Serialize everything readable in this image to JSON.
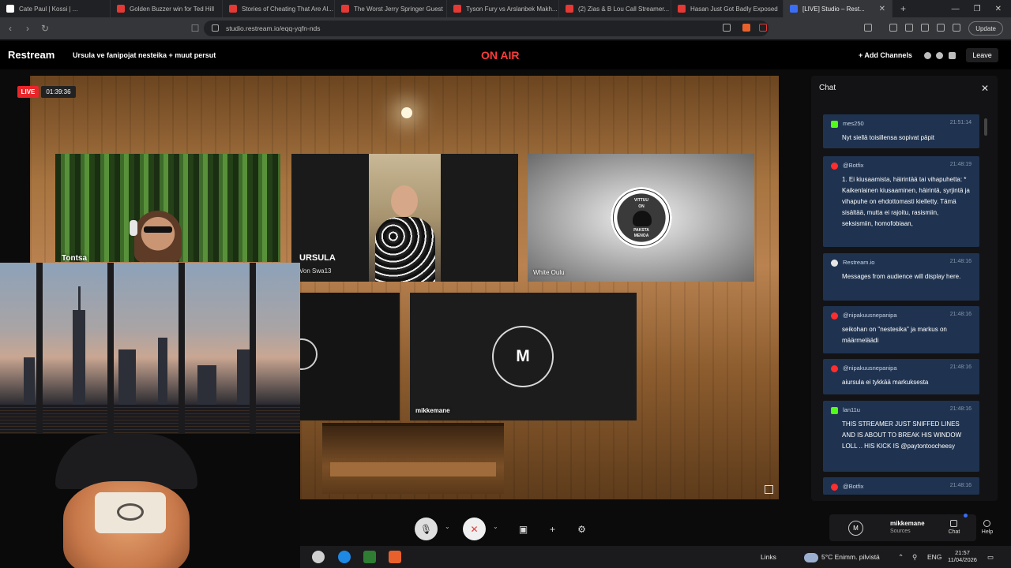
{
  "browser": {
    "tabs": [
      {
        "label": "Cate Paul | Kossi | ..."
      },
      {
        "label": "Golden Buzzer win for Ted Hill"
      },
      {
        "label": "Stories of Cheating That Are Al..."
      },
      {
        "label": "The Worst Jerry Springer Guest"
      },
      {
        "label": "Tyson Fury vs Arslanbek Makh..."
      },
      {
        "label": "(2) Zias & B Lou Call Streamer..."
      },
      {
        "label": "Hasan Just Got Badly Exposed"
      },
      {
        "label": "[LIVE] Studio – Rest..."
      }
    ],
    "url": "studio.restream.io/eqq-yqfn-nds",
    "update_label": "Update"
  },
  "header": {
    "brand": "Restream",
    "stream_title": "Ursula ve fanipojat nesteika + muut persut",
    "status": "ON AIR",
    "add_channels": "+ Add Channels",
    "leave": "Leave"
  },
  "stage": {
    "live_badge": "LIVE",
    "timer": "01:39:36",
    "participants": {
      "tontsa": "Tontsa",
      "ursula": "URSULA",
      "ursula_sub": "Von Swa13",
      "white_oulu": "White Oulu",
      "badge_top": "VITTUU",
      "badge_mid": "ON",
      "badge_bot1": "PAKSTA",
      "badge_bot2": "MENOA",
      "mikkemane": "mikkemane",
      "mikkemane_initial": "M"
    }
  },
  "chat": {
    "title": "Chat",
    "messages": [
      {
        "platform": "kick",
        "user": "mes250",
        "time": "21:51:14",
        "text": "Nyt siellä toisillensa sopivat päpit"
      },
      {
        "platform": "youtube",
        "user": "@Botfix",
        "time": "21:48:19",
        "text": "1. Ei kiusaamista, häirintää tai vihapuhetta: * Kaikenlainen kiusaaminen, häirintä, syrjintä ja vihapuhe on ehdottomasti kielletty. Tämä sisältää, mutta ei rajoitu, rasismiin, seksismiin, homofobiaan,"
      },
      {
        "platform": "restream",
        "user": "Restream.io",
        "time": "21:48:16",
        "text": "Messages from audience will display here."
      },
      {
        "platform": "youtube",
        "user": "@nipakuusnepanipa",
        "time": "21:48:16",
        "text": "seikohan on \"nestesika\" ja markus on määrmeläädi"
      },
      {
        "platform": "youtube",
        "user": "@nipakuusnepanipa",
        "time": "21:48:16",
        "text": "aiursula ei tykkää markuksesta"
      },
      {
        "platform": "kick",
        "user": "lan11u",
        "time": "21:48:16",
        "text": "THIS STREAMER JUST SNIFFED LINES AND IS ABOUT TO BREAK HIS WINDOW LOLL .. HIS KICK IS @paytontoocheesy"
      },
      {
        "platform": "youtube",
        "user": "@Botfix",
        "time": "21:48:16",
        "text": ""
      }
    ]
  },
  "controls": {
    "source_initial": "M",
    "source_name": "mikkemane",
    "source_sub": "Sources",
    "chat_label": "Chat",
    "help_label": "Help"
  },
  "taskbar": {
    "links": "Links",
    "weather": "5°C  Enimm. pilvistä",
    "lang": "ENG",
    "time": "21:57",
    "date": "11/04/2026"
  },
  "colors": {
    "onair": "#ff3b3b",
    "live": "#e8262a",
    "chat_bubble": "#1f3350",
    "kick": "#53fc18",
    "youtube": "#ff2d2d"
  }
}
